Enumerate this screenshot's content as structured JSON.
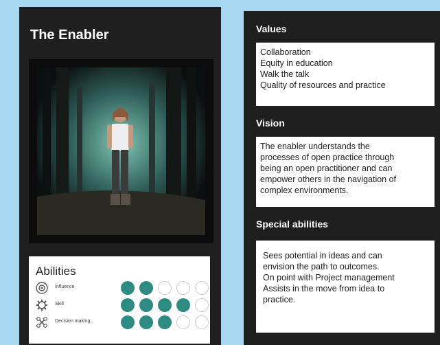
{
  "left": {
    "title": "The Enabler",
    "abilities": {
      "heading": "Abilities",
      "rows": [
        {
          "label": "Influence",
          "icon": "influence-icon",
          "level": 2,
          "max": 5
        },
        {
          "label": "Skill",
          "icon": "skill-icon",
          "level": 4,
          "max": 5
        },
        {
          "label": "Decision making",
          "icon": "decision-icon",
          "level": 3,
          "max": 5
        }
      ]
    }
  },
  "right": {
    "values": {
      "heading": "Values",
      "lines": [
        "Collaboration",
        "Equity in education",
        "Walk the talk",
        "Quality of resources and practice"
      ]
    },
    "vision": {
      "heading": "Vision",
      "lines": [
        "The enabler understands the",
        "processes of open practice through",
        "being an open practitioner and can",
        "empower others in the navigation of",
        "complex environments."
      ]
    },
    "special": {
      "heading": "Special abilities",
      "lines": [
        "Sees potential in ideas and can",
        "envision the path to outcomes.",
        "On point with Project management",
        "Assists in the move from idea to",
        "practice."
      ]
    }
  },
  "colors": {
    "filled_dot": "#2e8b82",
    "card_bg": "#1f1f1f",
    "page_bg": "#a8d8f0"
  }
}
